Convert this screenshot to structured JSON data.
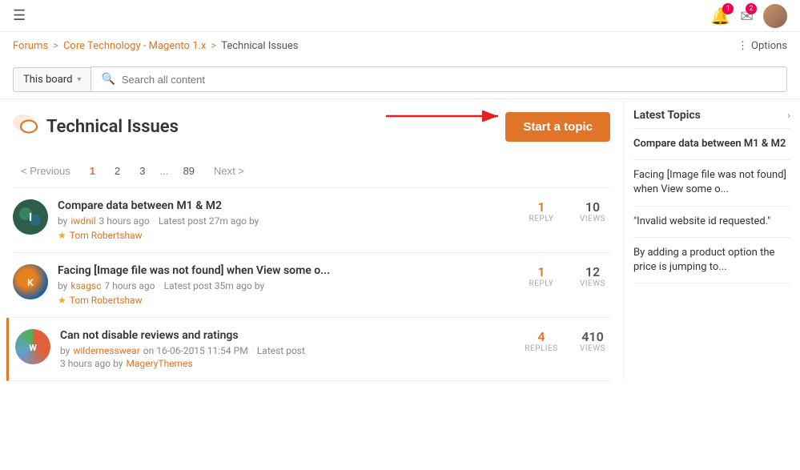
{
  "topbar": {
    "hamburger": "☰",
    "bell_badge": "1",
    "mail_badge": "2"
  },
  "breadcrumb": {
    "forums": "Forums",
    "separator1": ">",
    "core_tech": "Core Technology - Magento 1.x",
    "separator2": ">",
    "current": "Technical Issues",
    "options": "Options"
  },
  "search": {
    "board_label": "This board",
    "placeholder": "Search all content"
  },
  "page_title": "Technical Issues",
  "start_topic_btn": "Start a topic",
  "pagination": {
    "prev": "< Previous",
    "pages": [
      "1",
      "2",
      "3",
      "...",
      "89"
    ],
    "next": "Next >"
  },
  "topics": [
    {
      "id": 1,
      "title": "Compare data between M1 & M2",
      "author": "iwdnil",
      "time_ago": "3 hours ago",
      "latest_label": "Latest post 27m ago by",
      "latest_author": "Tom Robertshaw",
      "replies": 1,
      "replies_label": "REPLY",
      "views": 10,
      "views_label": "VIEWS",
      "avatar_type": "green-blue",
      "accent": false
    },
    {
      "id": 2,
      "title": "Facing [Image file was not found] when View some o...",
      "author": "ksagsc",
      "time_ago": "7 hours ago",
      "latest_label": "Latest post 35m ago by",
      "latest_author": "Tom Robertshaw",
      "replies": 1,
      "replies_label": "REPLY",
      "views": 12,
      "views_label": "VIEWS",
      "avatar_type": "orange-blue",
      "accent": false
    },
    {
      "id": 3,
      "title": "Can not disable reviews and ratings",
      "author": "wildernesswear",
      "time_ago": "on 16-06-2015 11:54 PM",
      "latest_label": "Latest post",
      "latest_time": "3 hours ago by",
      "latest_author": "MageryThemes",
      "replies": 4,
      "replies_label": "REPLIES",
      "views": 410,
      "views_label": "VIEWS",
      "avatar_type": "colorful",
      "accent": true
    }
  ],
  "sidebar": {
    "title": "Latest Topics",
    "items": [
      "Compare data between M1 & M2",
      "Facing [Image file was not found] when View some o...",
      "“Invalid website id requested.”",
      "By adding a product option the price is jumping to..."
    ]
  },
  "colors": {
    "accent": "#e07428",
    "link": "#e07428",
    "text": "#333",
    "muted": "#888"
  }
}
